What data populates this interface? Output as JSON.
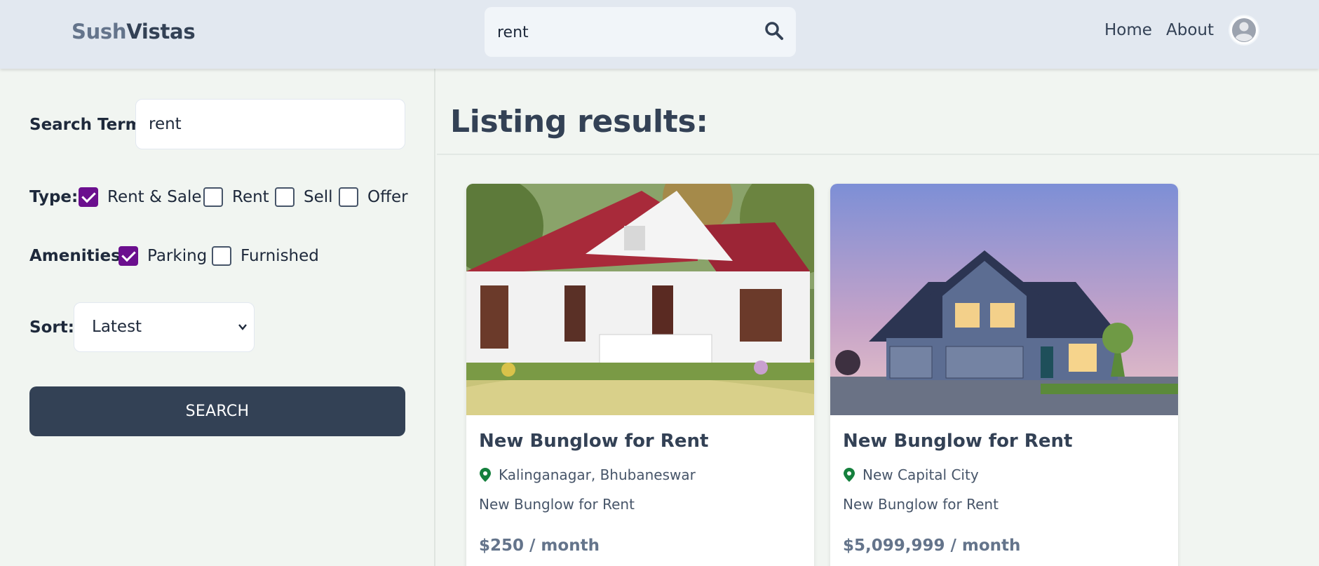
{
  "header": {
    "logo_part1": "Sush",
    "logo_part2": "Vistas",
    "search_value": "rent",
    "nav": {
      "home": "Home",
      "about": "About"
    }
  },
  "sidebar": {
    "search_term_label": "Search Term:",
    "search_term_value": "rent",
    "type_label": "Type:",
    "type_options": [
      {
        "label": "Rent & Sale",
        "checked": true
      },
      {
        "label": "Rent",
        "checked": false
      },
      {
        "label": "Sell",
        "checked": false
      },
      {
        "label": "Offer",
        "checked": false
      }
    ],
    "amenities_label": "Amenities:",
    "amenities_options": [
      {
        "label": "Parking",
        "checked": true
      },
      {
        "label": "Furnished",
        "checked": false
      }
    ],
    "sort_label": "Sort:",
    "sort_value": "Latest",
    "search_button": "SEARCH"
  },
  "main": {
    "title": "Listing results:",
    "listings": [
      {
        "title": "New Bunglow for Rent",
        "location": "Kalinganagar, Bhubaneswar",
        "description": "New Bunglow for Rent",
        "price": "$250 / month"
      },
      {
        "title": "New Bunglow for Rent",
        "location": "New Capital City",
        "description": "New Bunglow for Rent",
        "price": "$5,099,999 / month"
      }
    ]
  },
  "colors": {
    "header_bg": "#e2e8f0",
    "page_bg": "#f1f5f1",
    "primary_dark": "#334155",
    "checkbox_checked": "#6b0f8e",
    "pin_green": "#15803d"
  }
}
